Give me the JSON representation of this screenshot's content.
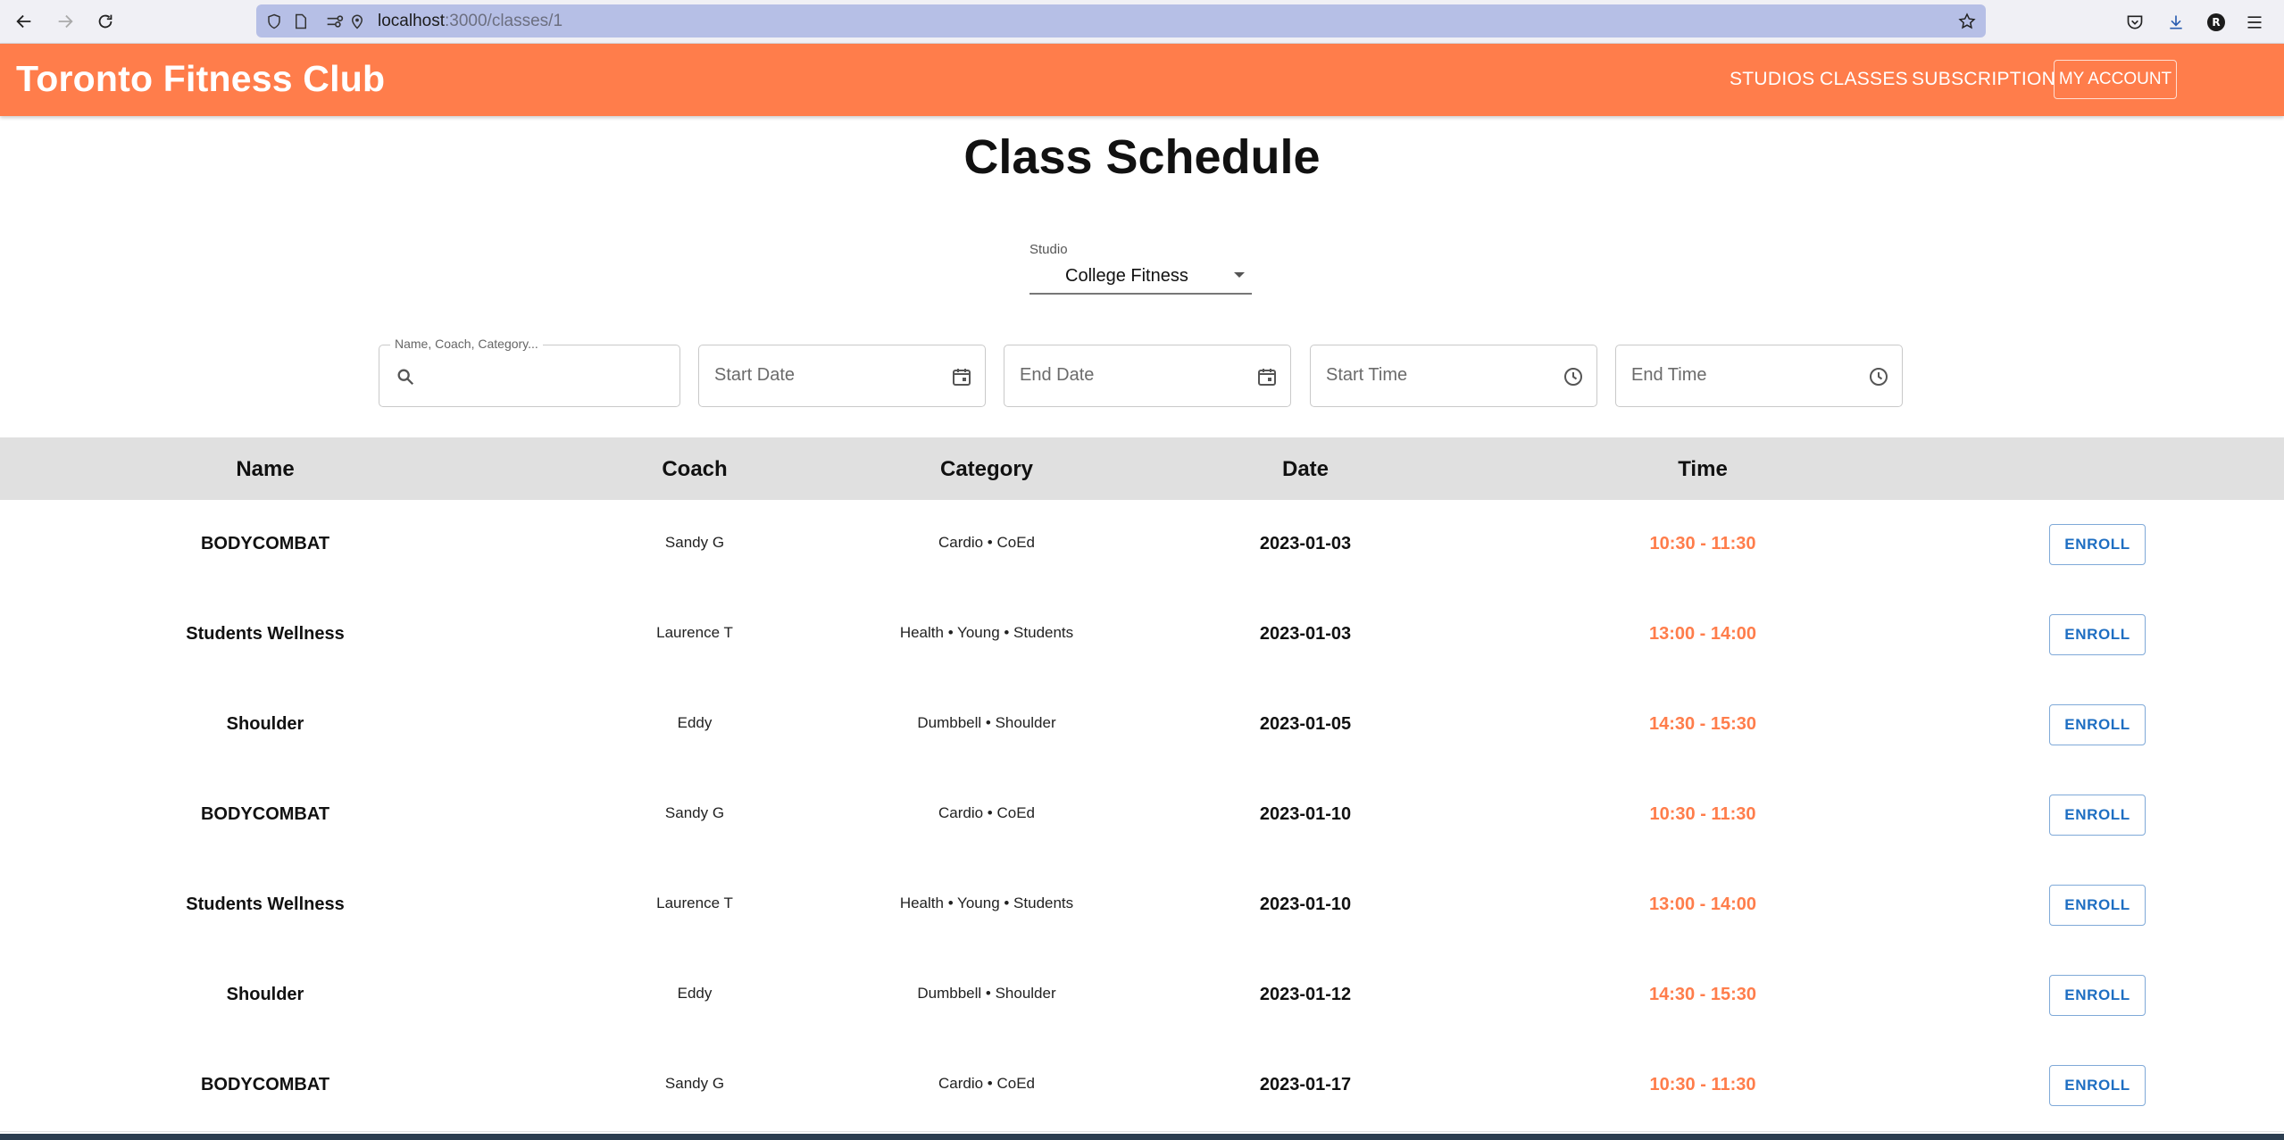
{
  "browser": {
    "url_host": "localhost",
    "url_rest": ":3000/classes/1",
    "avatar_letter": "R"
  },
  "header": {
    "brand": "Toronto Fitness Club",
    "nav": [
      "STUDIOS",
      "CLASSES",
      "SUBSCRIPTION"
    ],
    "account_label": "MY ACCOUNT"
  },
  "page": {
    "title": "Class Schedule"
  },
  "studio": {
    "label": "Studio",
    "value": "College Fitness"
  },
  "filters": {
    "search_label": "Name, Coach, Category...",
    "start_date": "Start Date",
    "end_date": "End Date",
    "start_time": "Start Time",
    "end_time": "End Time"
  },
  "table": {
    "headers": [
      "Name",
      "Coach",
      "Category",
      "Date",
      "Time"
    ],
    "enroll_label": "ENROLL",
    "rows": [
      {
        "name": "BODYCOMBAT",
        "coach": "Sandy G",
        "category": "Cardio • CoEd",
        "date": "2023-01-03",
        "time": "10:30 - 11:30"
      },
      {
        "name": "Students Wellness",
        "coach": "Laurence T",
        "category": "Health • Young • Students",
        "date": "2023-01-03",
        "time": "13:00 - 14:00"
      },
      {
        "name": "Shoulder",
        "coach": "Eddy",
        "category": "Dumbbell • Shoulder",
        "date": "2023-01-05",
        "time": "14:30 - 15:30"
      },
      {
        "name": "BODYCOMBAT",
        "coach": "Sandy G",
        "category": "Cardio • CoEd",
        "date": "2023-01-10",
        "time": "10:30 - 11:30"
      },
      {
        "name": "Students Wellness",
        "coach": "Laurence T",
        "category": "Health • Young • Students",
        "date": "2023-01-10",
        "time": "13:00 - 14:00"
      },
      {
        "name": "Shoulder",
        "coach": "Eddy",
        "category": "Dumbbell • Shoulder",
        "date": "2023-01-12",
        "time": "14:30 - 15:30"
      },
      {
        "name": "BODYCOMBAT",
        "coach": "Sandy G",
        "category": "Cardio • CoEd",
        "date": "2023-01-17",
        "time": "10:30 - 11:30"
      }
    ]
  },
  "colors": {
    "brand": "#ff7d4b",
    "enroll_text": "#1e6ec2",
    "header_row": "#e0e0e0"
  }
}
